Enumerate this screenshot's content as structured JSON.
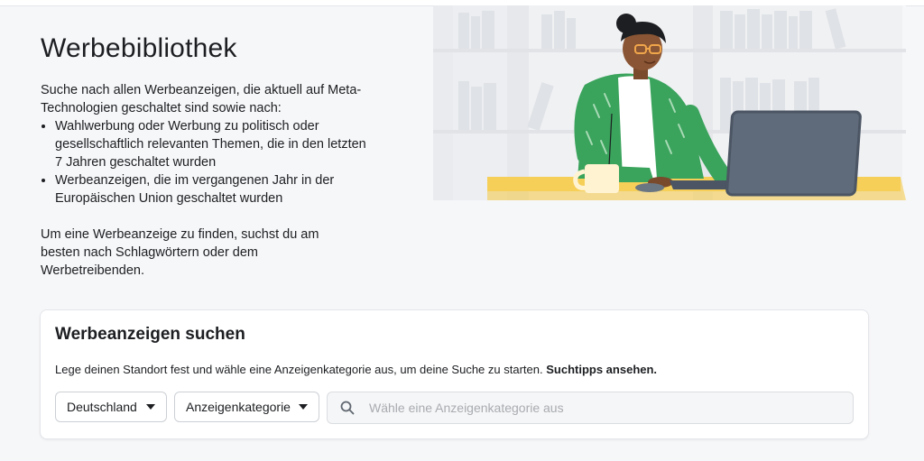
{
  "intro": {
    "title": "Werbebibliothek",
    "description": "Suche nach allen Werbeanzeigen, die aktuell auf Meta-Technologien geschaltet sind sowie nach:",
    "bullets": [
      "Wahlwerbung oder Werbung zu politisch oder gesellschaftlich relevanten Themen, die in den letzten 7 Jahren geschaltet wurden",
      "Werbeanzeigen, die im vergangenen Jahr in der Europäischen Union geschaltet wurden"
    ],
    "hint": "Um eine Werbeanzeige zu finden, suchst du am besten nach Schlagwörtern oder dem Werbetreibenden."
  },
  "search_card": {
    "title": "Werbeanzeigen suchen",
    "instruction": "Lege deinen Standort fest und wähle eine Anzeigenkategorie aus, um deine Suche zu starten.",
    "tips_link": "Suchtipps ansehen.",
    "country_dropdown": "Deutschland",
    "category_dropdown": "Anzeigenkategorie",
    "search_placeholder": "Wähle eine Anzeigenkategorie aus"
  },
  "icons": {
    "search": "search-icon",
    "dropdown": "caret-down-icon"
  },
  "colors": {
    "page_background": "#f6f7f9",
    "card_background": "#ffffff",
    "jacket_green": "#3aa35c",
    "desk_yellow": "#f7d56a",
    "monitor_gray": "#5f6b7a"
  }
}
